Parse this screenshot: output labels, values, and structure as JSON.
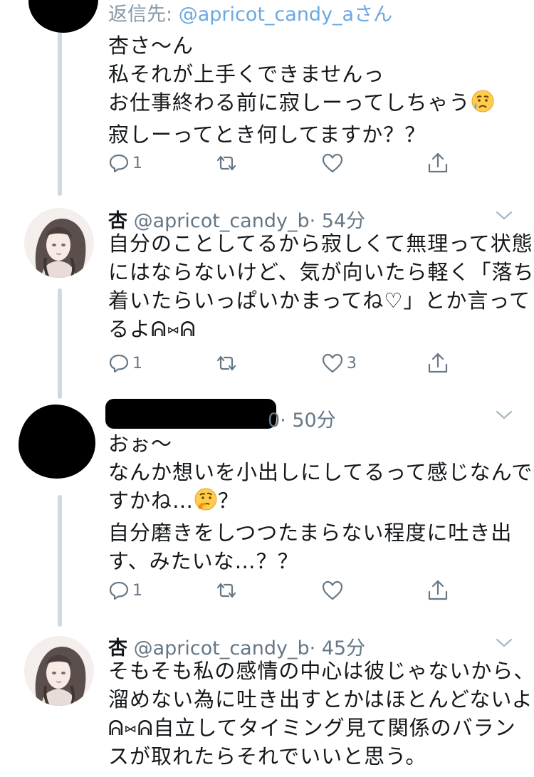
{
  "colors": {
    "link": "#6aa8e3",
    "meta": "#657786",
    "thread": "#cfd9de",
    "icon": "#657786"
  },
  "tweet1": {
    "reply_prefix": "返信先: ",
    "reply_handle": "@apricot_candy_aさん",
    "lines": [
      "杏さ〜ん",
      "私それが上手くできませんっ",
      "お仕事終わる前に寂しーってしちゃう",
      "寂しーってとき何してますか？？"
    ],
    "emoji": "crying-face",
    "reply_count": "1",
    "retweet_count": "",
    "like_count": ""
  },
  "tweet2": {
    "name": "杏",
    "handle": "@apricot_candy_b",
    "time": "· 54分",
    "lines": [
      "自分のことしてるから寂しくて無理って状態",
      "にはならないけど、気が向いたら軽く「落ち",
      "着いたらいっぱいかまってね♡」とか言って",
      "るよᕱ⑅ᕱ"
    ],
    "reply_count": "1",
    "retweet_count": "",
    "like_count": "3"
  },
  "tweet3": {
    "handle_tail": "0",
    "time": "· 50分",
    "lines": [
      "おぉ〜",
      "なんか想いを小出しにしてるって感じなんで",
      "すかね…",
      "自分磨きをしつつたまらない程度に吐き出",
      "す、みたいな…？？"
    ],
    "line3_suffix": "？",
    "emoji": "thinking-face",
    "reply_count": "1",
    "retweet_count": "",
    "like_count": ""
  },
  "tweet4": {
    "name": "杏",
    "handle": "@apricot_candy_b",
    "time": "· 45分",
    "lines": [
      "そもそも私の感情の中心は彼じゃないから、",
      "溜めない為に吐き出すとかはほとんどないよ",
      "ᕱ⑅ᕱ自立してタイミング見て関係のバラン",
      "スが取れたらそれでいいと思う。"
    ]
  }
}
